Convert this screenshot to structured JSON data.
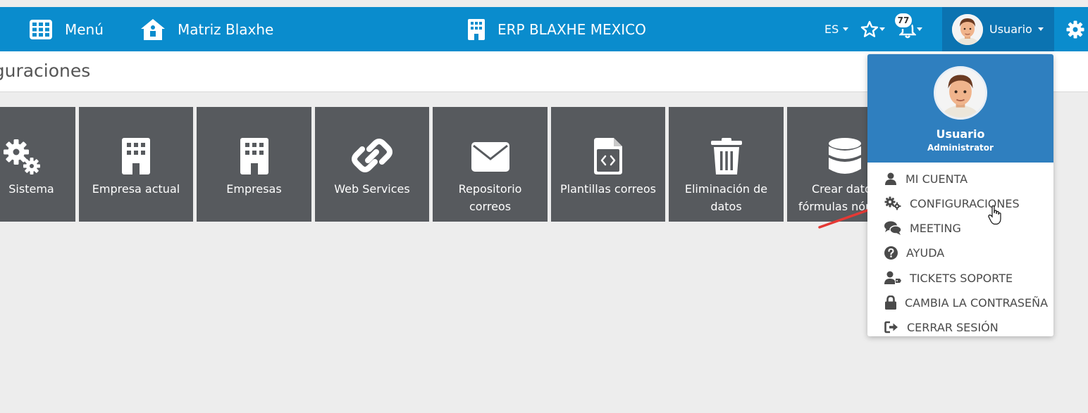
{
  "navbar": {
    "menu_label": "Menú",
    "home_label": "Matriz Blaxhe",
    "company_label": "ERP BLAXHE MEXICO",
    "language": "ES",
    "notification_count": "77",
    "user_label": "Usuario",
    "bg_color": "#0a8ccd"
  },
  "page": {
    "title": "figuraciones"
  },
  "tiles": [
    {
      "label": "Sistema",
      "icon": "gears-icon"
    },
    {
      "label": "Empresa actual",
      "icon": "building-icon"
    },
    {
      "label": "Empresas",
      "icon": "building-icon"
    },
    {
      "label": "Web Services",
      "icon": "link-icon"
    },
    {
      "label": "Repositorio",
      "label2": "correos",
      "icon": "envelope-icon"
    },
    {
      "label": "Plantillas correos",
      "icon": "code-file-icon"
    },
    {
      "label": "Eliminación de",
      "label2": "datos",
      "icon": "trash-icon"
    },
    {
      "label": "Crear datos",
      "label2": "fórmulas nóm",
      "icon": "database-icon"
    }
  ],
  "dropdown": {
    "name": "Usuario",
    "role": "Administrator",
    "items": [
      {
        "label": "MI CUENTA",
        "icon": "user-icon"
      },
      {
        "label": "CONFIGURACIONES",
        "icon": "gears-icon"
      },
      {
        "label": "MEETING",
        "icon": "comments-icon"
      },
      {
        "label": "AYUDA",
        "icon": "question-circle-icon"
      },
      {
        "label": "TICKETS SOPORTE",
        "icon": "user-tag-icon"
      },
      {
        "label": "CAMBIA LA CONTRASEÑA",
        "icon": "lock-icon"
      },
      {
        "label": "CERRAR SESIÓN",
        "icon": "sign-out-icon"
      }
    ]
  }
}
